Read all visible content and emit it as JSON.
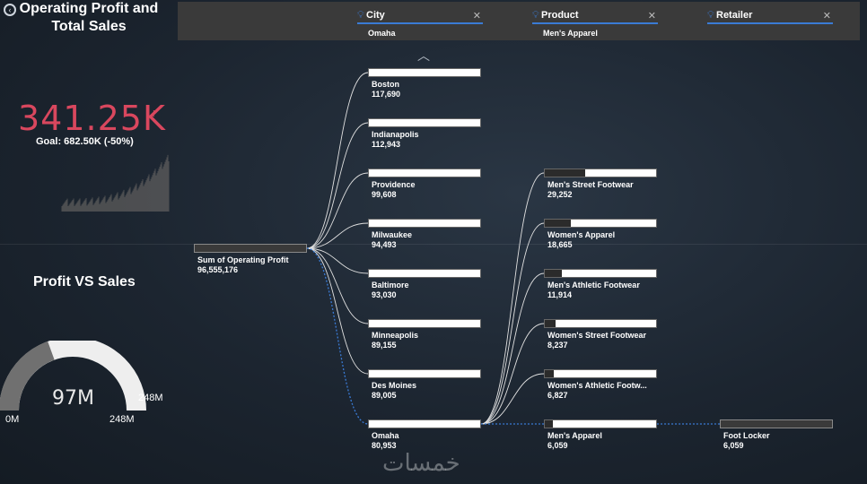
{
  "title": "Operating Profit and Total Sales",
  "kpi": {
    "value": "341.25K",
    "goal": "Goal: 682.50K (-50%)",
    "tick": "!"
  },
  "gauge": {
    "title": "Profit VS Sales",
    "value": "97M",
    "min": "0M",
    "max": "248M",
    "target": "248M",
    "fill_fraction": 0.39
  },
  "filters": [
    {
      "label": "City",
      "value": "Omaha"
    },
    {
      "label": "Product",
      "value": "Men's Apparel"
    },
    {
      "label": "Retailer",
      "value": ""
    }
  ],
  "root": {
    "label": "Sum of Operating Profit",
    "value": "96,555,176"
  },
  "cities": [
    {
      "label": "Boston",
      "value": "117,690"
    },
    {
      "label": "Indianapolis",
      "value": "112,943"
    },
    {
      "label": "Providence",
      "value": "99,608"
    },
    {
      "label": "Milwaukee",
      "value": "94,493"
    },
    {
      "label": "Baltimore",
      "value": "93,030"
    },
    {
      "label": "Minneapolis",
      "value": "89,155"
    },
    {
      "label": "Des Moines",
      "value": "89,005"
    },
    {
      "label": "Omaha",
      "value": "80,953"
    }
  ],
  "products": [
    {
      "label": "Men's Street Footwear",
      "value": "29,252",
      "fill": 0.36
    },
    {
      "label": "Women's Apparel",
      "value": "18,665",
      "fill": 0.23
    },
    {
      "label": "Men's Athletic Footwear",
      "value": "11,914",
      "fill": 0.15
    },
    {
      "label": "Women's Street Footwear",
      "value": "8,237",
      "fill": 0.1
    },
    {
      "label": "Women's Athletic Footw...",
      "value": "6,827",
      "fill": 0.08
    },
    {
      "label": "Men's Apparel",
      "value": "6,059",
      "fill": 0.07
    }
  ],
  "retailer": {
    "label": "Foot Locker",
    "value": "6,059"
  },
  "watermark": "خمسات"
}
